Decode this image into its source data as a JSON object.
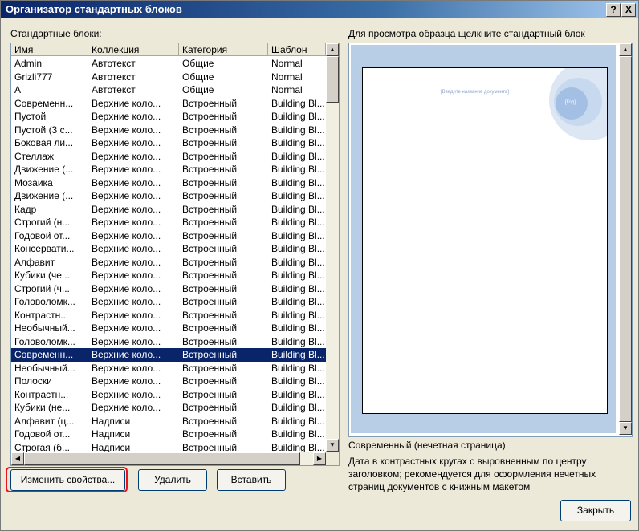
{
  "window": {
    "title": "Организатор стандартных блоков",
    "help_label": "?",
    "close_label": "X"
  },
  "list": {
    "label": "Стандартные блоки:",
    "columns": [
      "Имя",
      "Коллекция",
      "Категория",
      "Шаблон"
    ],
    "rows": [
      [
        "Admin",
        "Автотекст",
        "Общие",
        "Normal"
      ],
      [
        "Grizli777",
        "Автотекст",
        "Общие",
        "Normal"
      ],
      [
        "А",
        "Автотекст",
        "Общие",
        "Normal"
      ],
      [
        "Современн...",
        "Верхние коло...",
        "Встроенный",
        "Building Bl..."
      ],
      [
        " Пустой",
        "Верхние коло...",
        "Встроенный",
        "Building Bl..."
      ],
      [
        " Пустой (3 с...",
        "Верхние коло...",
        "Встроенный",
        "Building Bl..."
      ],
      [
        "Боковая ли...",
        "Верхние коло...",
        "Встроенный",
        "Building Bl..."
      ],
      [
        "Стеллаж",
        "Верхние коло...",
        "Встроенный",
        "Building Bl..."
      ],
      [
        "Движение (...",
        "Верхние коло...",
        "Встроенный",
        "Building Bl..."
      ],
      [
        "Мозаика",
        "Верхние коло...",
        "Встроенный",
        "Building Bl..."
      ],
      [
        "Движение (...",
        "Верхние коло...",
        "Встроенный",
        "Building Bl..."
      ],
      [
        "Кадр",
        "Верхние коло...",
        "Встроенный",
        "Building Bl..."
      ],
      [
        "Строгий (н...",
        "Верхние коло...",
        "Встроенный",
        "Building Bl..."
      ],
      [
        "Годовой от...",
        "Верхние коло...",
        "Встроенный",
        "Building Bl..."
      ],
      [
        "Консервати...",
        "Верхние коло...",
        "Встроенный",
        "Building Bl..."
      ],
      [
        "Алфавит",
        "Верхние коло...",
        "Встроенный",
        "Building Bl..."
      ],
      [
        "Кубики (че...",
        "Верхние коло...",
        "Встроенный",
        "Building Bl..."
      ],
      [
        "Строгий (ч...",
        "Верхние коло...",
        "Встроенный",
        "Building Bl..."
      ],
      [
        "Головоломк...",
        "Верхние коло...",
        "Встроенный",
        "Building Bl..."
      ],
      [
        "Контрастн...",
        "Верхние коло...",
        "Встроенный",
        "Building Bl..."
      ],
      [
        "Необычный...",
        "Верхние коло...",
        "Встроенный",
        "Building Bl..."
      ],
      [
        "Головоломк...",
        "Верхние коло...",
        "Встроенный",
        "Building Bl..."
      ],
      [
        "Современн...",
        "Верхние коло...",
        "Встроенный",
        "Building Bl..."
      ],
      [
        "Необычный...",
        "Верхние коло...",
        "Встроенный",
        "Building Bl..."
      ],
      [
        "Полоски",
        "Верхние коло...",
        "Встроенный",
        "Building Bl..."
      ],
      [
        "Контрастн...",
        "Верхние коло...",
        "Встроенный",
        "Building Bl..."
      ],
      [
        "Кубики (не...",
        "Верхние коло...",
        "Встроенный",
        "Building Bl..."
      ],
      [
        "Алфавит (ц...",
        "Надписи",
        "Встроенный",
        "Building Bl..."
      ],
      [
        "Годовой от...",
        "Надписи",
        "Встроенный",
        "Building Bl..."
      ],
      [
        "Строгая (б...",
        "Надписи",
        "Встроенный",
        "Building Bl..."
      ]
    ],
    "selected_index": 22
  },
  "buttons": {
    "edit": "Изменить свойства...",
    "delete": "Удалить",
    "insert": "Вставить",
    "close": "Закрыть"
  },
  "preview": {
    "label": "Для просмотра образца щелкните стандартный блок",
    "doc_title_placeholder": "[Введите название документа]",
    "year_placeholder": "[Год]",
    "name": "Современный (нечетная страница)",
    "description": "Дата в контрастных кругах с выровненным по центру заголовком; рекомендуется для оформления нечетных страниц документов с книжным макетом"
  },
  "colors": {
    "selection": "#0a246a",
    "highlight_frame": "#e8141e",
    "preview_bg": "#b8cde6"
  }
}
